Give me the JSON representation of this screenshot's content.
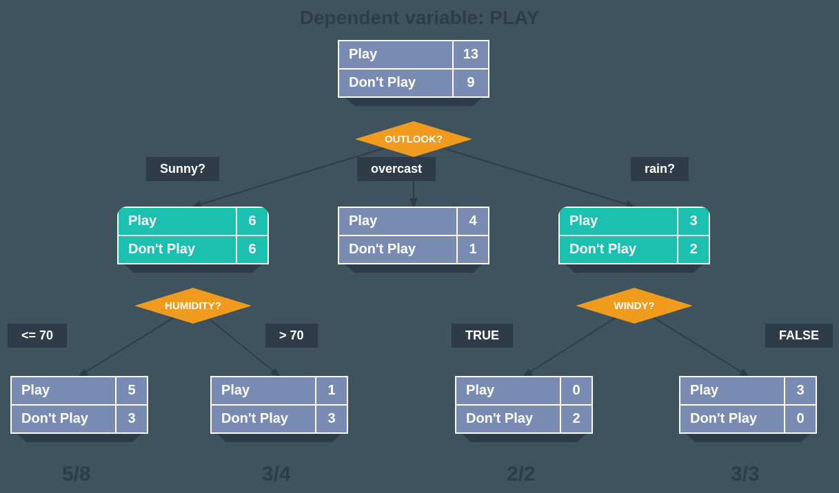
{
  "title": "Dependent variable: PLAY",
  "labels": {
    "play": "Play",
    "dont": "Don't Play"
  },
  "root": {
    "play": "13",
    "dont": "9"
  },
  "decision_root": "OUTLOOK?",
  "branch_labels": {
    "sunny": "Sunny?",
    "overcast": "overcast",
    "rain": "rain?"
  },
  "sunny": {
    "play": "6",
    "dont": "6"
  },
  "overcast": {
    "play": "4",
    "dont": "1"
  },
  "rain": {
    "play": "3",
    "dont": "2"
  },
  "decision_sunny": "HUMIDITY?",
  "decision_rain": "WINDY?",
  "humidity_labels": {
    "low": "<= 70",
    "high": "> 70"
  },
  "windy_labels": {
    "t": "TRUE",
    "f": "FALSE"
  },
  "leaves": {
    "hlow": {
      "play": "5",
      "dont": "3"
    },
    "hhigh": {
      "play": "1",
      "dont": "3"
    },
    "wt": {
      "play": "0",
      "dont": "2"
    },
    "wf": {
      "play": "3",
      "dont": "0"
    }
  },
  "ratios": {
    "r1": "5/8",
    "r2": "3/4",
    "r3": "2/2",
    "r4": "3/3"
  }
}
